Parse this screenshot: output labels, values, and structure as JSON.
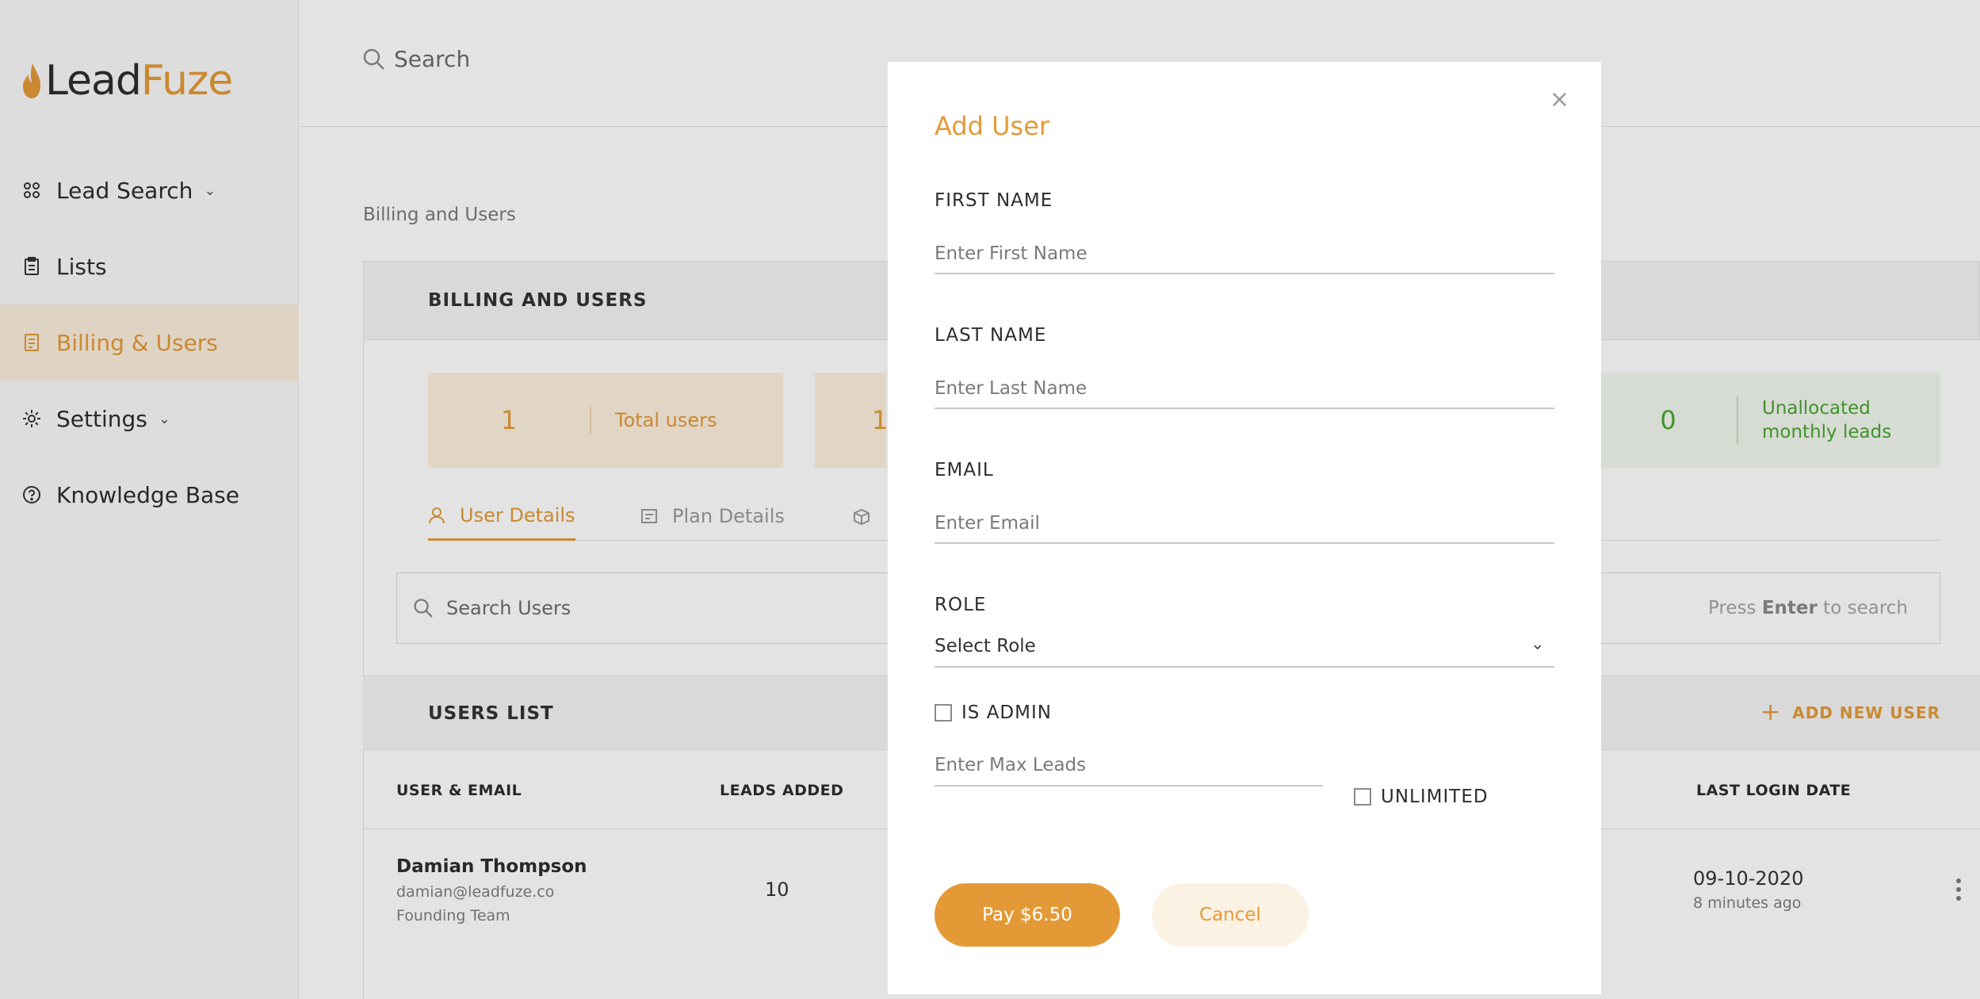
{
  "brand": {
    "logo_part1": "Lead",
    "logo_part2": "Fuze",
    "accent_color": "#e39a36",
    "success_color": "#4aa531"
  },
  "sidebar": {
    "items": [
      {
        "label": "Lead Search",
        "icon": "grid-icon",
        "has_caret": true
      },
      {
        "label": "Lists",
        "icon": "clipboard-icon",
        "has_caret": false
      },
      {
        "label": "Billing & Users",
        "icon": "receipt-icon",
        "has_caret": false,
        "active": true
      },
      {
        "label": "Settings",
        "icon": "gear-icon",
        "has_caret": true
      },
      {
        "label": "Knowledge Base",
        "icon": "help-circle-icon",
        "has_caret": false
      }
    ]
  },
  "topbar": {
    "search_placeholder": "Search"
  },
  "breadcrumb": "Billing and Users",
  "billing": {
    "title": "BILLING AND USERS",
    "stats": [
      {
        "value": "1",
        "label": "Total users"
      },
      {
        "value": "1",
        "label": ""
      },
      {
        "value": "0",
        "label_line1": "Unallocated",
        "label_line2": "monthly leads"
      }
    ],
    "tabs": [
      {
        "label": "User Details",
        "active": true
      },
      {
        "label": "Plan Details",
        "active": false
      },
      {
        "label": "",
        "active": false
      }
    ],
    "search_placeholder": "Search Users",
    "search_hint_prefix": "Press ",
    "search_hint_key": "Enter",
    "search_hint_suffix": " to search"
  },
  "users_list": {
    "title": "USERS LIST",
    "add_button": "ADD NEW USER",
    "columns": {
      "user_email": "USER & EMAIL",
      "leads_added": "LEADS ADDED",
      "last_login": "LAST LOGIN DATE"
    },
    "rows": [
      {
        "name": "Damian Thompson",
        "email": "damian@leadfuze.co",
        "team": "Founding Team",
        "leads_added": "10",
        "last_login": "09-10-2020",
        "last_login_ago": "8 minutes ago"
      }
    ]
  },
  "modal": {
    "title": "Add User",
    "close_label": "×",
    "first_name": {
      "label": "FIRST NAME",
      "placeholder": "Enter First Name",
      "value": ""
    },
    "last_name": {
      "label": "LAST NAME",
      "placeholder": "Enter Last Name",
      "value": ""
    },
    "email": {
      "label": "EMAIL",
      "placeholder": "Enter Email",
      "value": ""
    },
    "role": {
      "label": "ROLE",
      "selected": "Select Role"
    },
    "is_admin": {
      "label": "IS ADMIN",
      "checked": false
    },
    "max_leads": {
      "placeholder": "Enter Max Leads",
      "value": ""
    },
    "unlimited": {
      "label": "UNLIMITED",
      "checked": false
    },
    "pay_button": "Pay $6.50",
    "cancel_button": "Cancel"
  }
}
